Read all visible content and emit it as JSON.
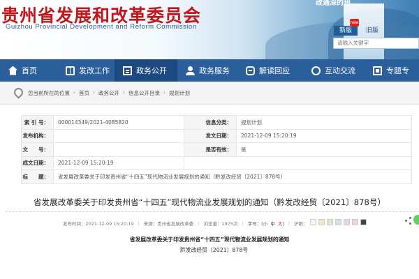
{
  "header": {
    "site_name_zh": "贵州省发展和改革委员会",
    "site_name_en": "Guizhou Provincial Development and Reform Commission",
    "top_link": "政通深的州",
    "version_new": "新版",
    "new_badge": "new",
    "version_old": "旧版",
    "search_placeholder": "请输入关键字"
  },
  "nav": {
    "items": [
      {
        "label": "首页",
        "icon": "home-icon"
      },
      {
        "label": "发改工作",
        "icon": "book-icon"
      },
      {
        "label": "政务公开",
        "icon": "document-icon"
      },
      {
        "label": "政务服务",
        "icon": "person-icon"
      },
      {
        "label": "解读回应",
        "icon": "chat-icon"
      },
      {
        "label": "互动交流",
        "icon": "bubble-icon"
      },
      {
        "label": "专题专",
        "icon": "topic-icon"
      }
    ],
    "active": "政务公开"
  },
  "breadcrumb": {
    "prefix": "您当前所在的位置",
    "items": [
      "首页",
      "政务公开",
      "信息公开目录",
      "规划计划"
    ]
  },
  "info": {
    "index_label": "索 引 号：",
    "index_value": "000014349/2021-4085820",
    "category_label": "信息分类：",
    "category_value": "规划计划",
    "publisher_label": "发布机构：",
    "publisher_value": "",
    "docno_label": "发文日期：",
    "docno_value": "",
    "wenhao_label": "文　　号：",
    "wenhao_value": "",
    "valid_label": "是否有效：",
    "valid_value": "是",
    "date_label": "成文日期：",
    "date_value": "2021-12-09 15:20:19",
    "extra_date_value": "2021-12-09 15:20:19",
    "title_label": "标　　题：",
    "title_value": "省发展改革委关于印发贵州省“十四五”现代物流业发展规划的通知（黔发改经贸〔2021〕878号）"
  },
  "article": {
    "title": "省发展改革委关于印发贵州省“十四五”现代物流业发展规划的通知（黔发改经贸〔2021〕878号）",
    "meta_date": "发布时间：2021-12-09 15:20:19",
    "meta_source": "来源：贵州省发展改革委",
    "meta_views": "浏览量：1975次",
    "font_prefix": "字号：[",
    "font_small": "小",
    "font_mid": "中",
    "font_big": "大",
    "font_suffix": "]",
    "color_label": "护眼：",
    "swatch_colors": [
      "#f4f4f4",
      "#f0e6c8",
      "#dfe8cf",
      "#cfe0ef",
      "#e8d6e8",
      "#f0d8d0",
      "#444444"
    ],
    "body_title": "省发展改革委关于印发贵州省“十四五”现代物流业发展规划的通知",
    "body_docno": "黔发改经贸〔2021〕878号"
  }
}
